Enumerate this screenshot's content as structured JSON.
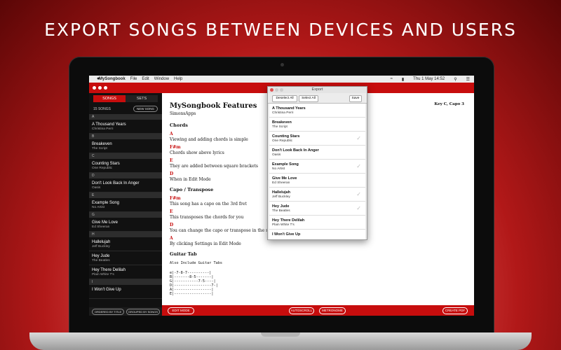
{
  "headline": "EXPORT SONGS BETWEEN DEVICES AND USERS",
  "menubar": {
    "app": "MySongbook",
    "menus": [
      "File",
      "Edit",
      "Window",
      "Help"
    ],
    "clock": "Thu 1 May  14:52"
  },
  "sidebar": {
    "tabs": [
      "SONGS",
      "SETS"
    ],
    "song_count": "15 SONGS",
    "new_song": "NEW SONG",
    "sections": [
      {
        "letter": "A",
        "songs": [
          {
            "title": "A Thousand Years",
            "artist": "Christina Perri"
          }
        ]
      },
      {
        "letter": "B",
        "songs": [
          {
            "title": "Breakeven",
            "artist": "The Script"
          }
        ]
      },
      {
        "letter": "C",
        "songs": [
          {
            "title": "Counting Stars",
            "artist": "One Republic"
          }
        ]
      },
      {
        "letter": "D",
        "songs": [
          {
            "title": "Don't Look Back In Anger",
            "artist": "Oasis"
          }
        ]
      },
      {
        "letter": "E",
        "songs": [
          {
            "title": "Example Song",
            "artist": "No Artist"
          }
        ]
      },
      {
        "letter": "G",
        "songs": [
          {
            "title": "Give Me Love",
            "artist": "Ed Sheeran"
          }
        ]
      },
      {
        "letter": "H",
        "songs": [
          {
            "title": "Hallelujah",
            "artist": "Jeff Buckley"
          },
          {
            "title": "Hey Jude",
            "artist": "The Beatles"
          },
          {
            "title": "Hey There Delilah",
            "artist": "Plain White T's"
          }
        ]
      },
      {
        "letter": "I",
        "songs": [
          {
            "title": "I Won't Give Up",
            "artist": ""
          }
        ]
      }
    ],
    "footer": {
      "order_title": "ORDERED BY TITLE",
      "group_songs": "GROUPED BY SONGS"
    }
  },
  "main": {
    "title": "MySongbook Features",
    "artist": "SimonsApps",
    "key_capo": "Key C, Capo 3",
    "chords_heading": "Chords",
    "chords_lines": [
      {
        "chord": "A",
        "lyric": "Viewing and adding chords is simple"
      },
      {
        "chord": "F#m",
        "lyric": "Chords show above lyrics"
      },
      {
        "chord": "E",
        "lyric": "They are added between square brackets"
      },
      {
        "chord": "D",
        "lyric": "When in Edit Mode"
      }
    ],
    "capo_heading": "Capo / Transpose",
    "capo_lines": [
      {
        "chord": "F#m",
        "lyric": "This song has a capo on the 3rd fret"
      },
      {
        "chord": "E",
        "lyric": "This transposes the chords for you"
      },
      {
        "chord": "D",
        "lyric": "You can change the capo or transpose in the settings"
      },
      {
        "chord": "A",
        "lyric": "By clicking Settings in Edit Mode"
      }
    ],
    "tab_heading": "Guitar Tab",
    "tab_intro": "Also Include Guitar Tabs",
    "tab_lines": [
      "e|-7-8-7----------|",
      "B|-------8-5-------|",
      "G|-----------7-5----|",
      "D|-----------------7-|",
      "A|-----------------|",
      "E|-----------------|"
    ],
    "footer": {
      "edit_mode": "EDIT MODE",
      "autoscroll": "AUTOSCROLL",
      "metronome": "METRONOME",
      "create_pdf": "CREATE PDF"
    }
  },
  "export_dialog": {
    "title": "Export",
    "deselect_all": "Deselect All",
    "select_all": "Select All",
    "save": "Save",
    "items": [
      {
        "title": "A Thousand Years",
        "artist": "Christina Perri",
        "checked": false
      },
      {
        "title": "Breakeven",
        "artist": "The Script",
        "checked": false
      },
      {
        "title": "Counting Stars",
        "artist": "One Republic",
        "checked": true
      },
      {
        "title": "Don't Look Back In Anger",
        "artist": "Oasis",
        "checked": false
      },
      {
        "title": "Example Song",
        "artist": "No Artist",
        "checked": true
      },
      {
        "title": "Give Me Love",
        "artist": "Ed Sheeran",
        "checked": false
      },
      {
        "title": "Hallelujah",
        "artist": "Jeff Buckley",
        "checked": true
      },
      {
        "title": "Hey Jude",
        "artist": "The Beatles",
        "checked": true
      },
      {
        "title": "Hey There Delilah",
        "artist": "Plain White T's",
        "checked": false
      },
      {
        "title": "I Won't Give Up",
        "artist": "",
        "checked": false
      }
    ]
  },
  "colors": {
    "accent": "#c70d0d",
    "sidebar_bg": "#111111"
  }
}
